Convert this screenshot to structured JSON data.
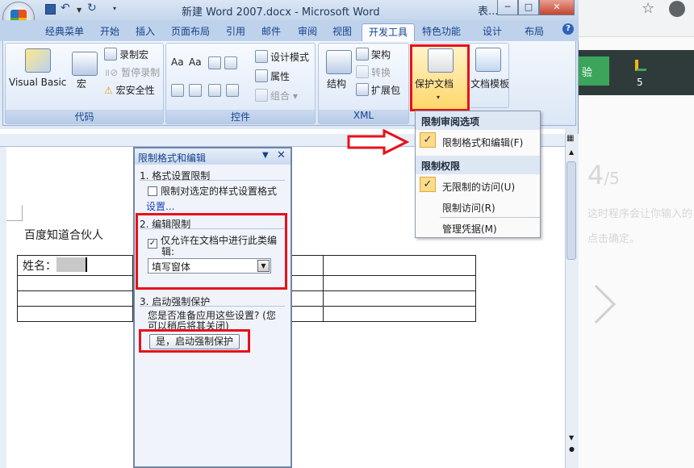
{
  "window": {
    "title": "新建 Word 2007.docx - Microsoft Word",
    "title_extra": "表...",
    "btn_min": "─",
    "btn_max": "□",
    "btn_close": "✕"
  },
  "tabs": [
    "经典菜单",
    "开始",
    "插入",
    "页面布局",
    "引用",
    "邮件",
    "审阅",
    "视图",
    "开发工具",
    "特色功能",
    "设计",
    "布局"
  ],
  "help": "?",
  "ribbon": {
    "code": {
      "label": "代码",
      "visual_basic": "Visual Basic",
      "macro": "宏",
      "record_macro": "录制宏",
      "pause_recording": "暂停录制",
      "macro_security": "宏安全性"
    },
    "controls": {
      "label": "控件",
      "design_mode": "设计模式",
      "properties": "属性",
      "group": "组合"
    },
    "xml": {
      "label": "XML",
      "structure": "结构",
      "schema": "架构",
      "transform": "转换",
      "expansion_pack": "扩展包"
    },
    "protect": {
      "protect_document": "保护文档",
      "document_template": "文档模板"
    }
  },
  "protect_menu": {
    "section1": "限制审阅选项",
    "restrict_formatting": "限制格式和编辑(F)",
    "section2": "限制权限",
    "unrestricted_access": "无限制的访问(U)",
    "restricted_access": "限制访问(R)",
    "manage_credentials": "管理凭据(M)"
  },
  "task_pane": {
    "title": "限制格式和编辑",
    "s1_title": "1. 格式设置限制",
    "s1_checkbox": "限制对选定的样式设置格式",
    "s1_link": "设置...",
    "s2_title": "2. 编辑限制",
    "s2_checkbox_line1": "仅允许在文档中进行此类编",
    "s2_checkbox_line2": "辑:",
    "s2_dropdown": "填写窗体",
    "s3_title": "3. 启动强制保护",
    "s3_text_line1": "您是否准备应用这些设置? (您",
    "s3_text_line2": "可以稍后将其关闭)",
    "s3_button": "是，启动强制保护"
  },
  "document": {
    "heading": "百度知道合伙人",
    "name_label": "姓名："
  },
  "background": {
    "experience_btn": "验",
    "count": "5",
    "step": "4",
    "step_total": "/5",
    "hint1": "这时程序会让你输入的",
    "hint2": "点击确定。"
  },
  "colors": {
    "highlight_red": "#e8101a",
    "ribbon_blue": "#15428b",
    "menu_check": "#fbdc8a"
  }
}
